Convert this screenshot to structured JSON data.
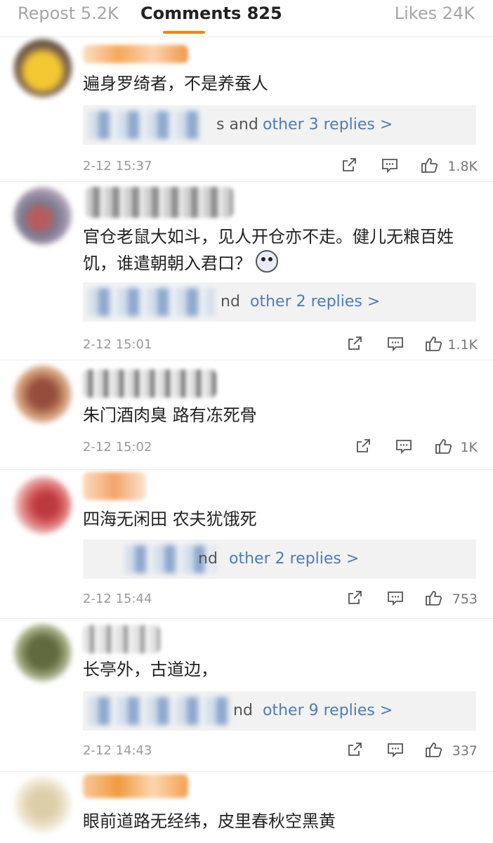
{
  "tabs": {
    "repost": "Repost 5.2K",
    "comments": "Comments 825",
    "likes": "Likes 24K",
    "accent": "#ff8200"
  },
  "comments": [
    {
      "text": "遍身罗绮者，不是养蚕人",
      "replies_partial": "s and",
      "replies_link": "other 3 replies >",
      "time": "2-12 15:37",
      "likes": "1.8K"
    },
    {
      "text": "官仓老鼠大如斗，见人开仓亦不走。健儿无粮百姓饥，谁遣朝朝入君口？",
      "replies_partial": "nd",
      "replies_link": "other 2 replies >",
      "time": "2-12 15:01",
      "likes": "1.1K"
    },
    {
      "text": "朱门酒肉臭 路有冻死骨",
      "time": "2-12 15:02",
      "likes": "1K"
    },
    {
      "text": "四海无闲田 农夫犹饿死",
      "replies_partial": "nd",
      "replies_link": "other 2 replies >",
      "time": "2-12 15:44",
      "likes": "753"
    },
    {
      "text": "长亭外，古道边，",
      "replies_partial": "nd",
      "replies_link": "other 9 replies >",
      "time": "2-12 14:43",
      "likes": "337"
    },
    {
      "text": "眼前道路无经纬，皮里春秋空黑黄"
    }
  ],
  "icons": {
    "share": "share-icon",
    "comment": "comment-icon",
    "like": "thumbs-up-icon"
  },
  "colors": {
    "link": "#4f7cb5",
    "reply_box": "#f2f2f2",
    "meta_text": "#9a9a9a"
  }
}
